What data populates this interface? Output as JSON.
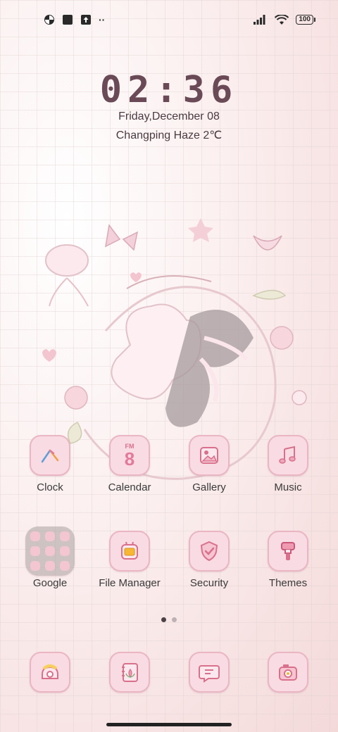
{
  "status_bar": {
    "left_icons": [
      "pinwheel-icon",
      "square-app-icon",
      "upload-icon",
      "more-dots-icon"
    ],
    "more_text": "··",
    "battery": "100"
  },
  "lockscreen": {
    "time": "02:36",
    "date": "Friday,December 08",
    "weather": "Changping Haze 2℃"
  },
  "apps_row1": [
    {
      "label": "Clock",
      "icon": "clock-icon"
    },
    {
      "label": "Calendar",
      "icon": "calendar-icon",
      "icon_text_top": "FM",
      "icon_text_num": "8"
    },
    {
      "label": "Gallery",
      "icon": "gallery-icon"
    },
    {
      "label": "Music",
      "icon": "music-icon"
    }
  ],
  "apps_row2": [
    {
      "label": "Google",
      "icon": "google-folder-icon"
    },
    {
      "label": "File Manager",
      "icon": "file-manager-icon"
    },
    {
      "label": "Security",
      "icon": "security-icon"
    },
    {
      "label": "Themes",
      "icon": "themes-icon"
    }
  ],
  "dock": [
    {
      "icon": "phone-icon"
    },
    {
      "icon": "contacts-icon"
    },
    {
      "icon": "messages-icon"
    },
    {
      "icon": "camera-icon"
    }
  ],
  "page_indicator": {
    "count": 2,
    "active": 0
  },
  "colors": {
    "accent": "#f9dbe3",
    "accent_border": "#eab6c4",
    "clock": "#6a4a56",
    "icon_stroke": "#d9708c"
  }
}
